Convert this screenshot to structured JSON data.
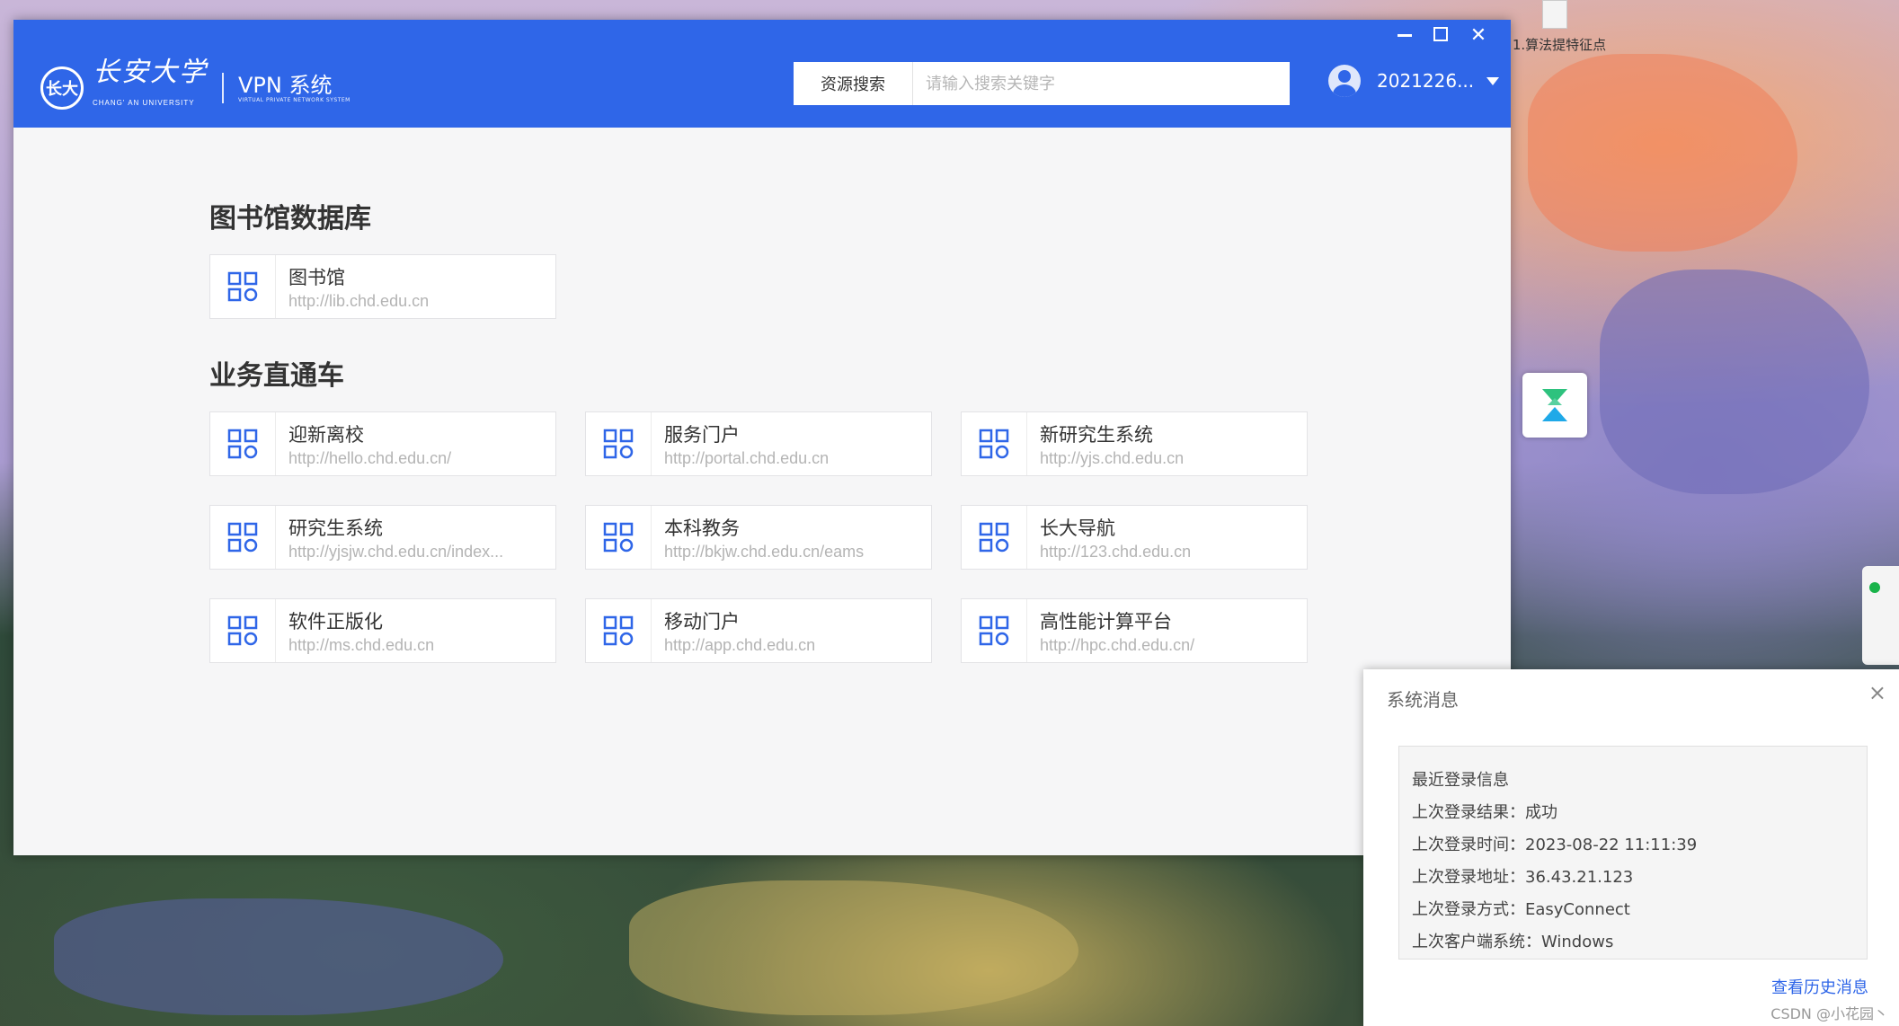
{
  "window": {
    "university_name": "长安大学",
    "university_sub": "CHANG' AN UNIVERSITY",
    "seal_text": "长大",
    "product_title": "VPN 系统",
    "product_sub": "VIRTUAL PRIVATE NETWORK SYSTEM",
    "brand_color": "#2f66e8"
  },
  "search": {
    "scope_label": "资源搜索",
    "placeholder": "请输入搜索关键字",
    "value": ""
  },
  "user": {
    "name": "2021226..."
  },
  "sections": [
    {
      "title": "图书馆数据库",
      "items": [
        {
          "name": "图书馆",
          "url": "http://lib.chd.edu.cn"
        }
      ]
    },
    {
      "title": "业务直通车",
      "items": [
        {
          "name": "迎新离校",
          "url": "http://hello.chd.edu.cn/"
        },
        {
          "name": "服务门户",
          "url": "http://portal.chd.edu.cn"
        },
        {
          "name": "新研究生系统",
          "url": "http://yjs.chd.edu.cn"
        },
        {
          "name": "研究生系统",
          "url": "http://yjsjw.chd.edu.cn/index..."
        },
        {
          "name": "本科教务",
          "url": "http://bkjw.chd.edu.cn/eams"
        },
        {
          "name": "长大导航",
          "url": "http://123.chd.edu.cn"
        },
        {
          "name": "软件正版化",
          "url": "http://ms.chd.edu.cn"
        },
        {
          "name": "移动门户",
          "url": "http://app.chd.edu.cn"
        },
        {
          "name": "高性能计算平台",
          "url": "http://hpc.chd.edu.cn/"
        }
      ]
    }
  ],
  "notification": {
    "title": "系统消息",
    "close_label": "×",
    "lines": [
      "最近登录信息",
      "上次登录结果：成功",
      "上次登录时间：2023-08-22 11:11:39",
      "上次登录地址：36.43.21.123",
      "上次登录方式：EasyConnect",
      "上次客户端系统：Windows"
    ],
    "history_link": "查看历史消息"
  },
  "desktop": {
    "icon_label": "1.算法提特征点",
    "watermark": "CSDN @小花园丶"
  },
  "icons": {
    "resource": "app-grid-icon",
    "close": "close-icon",
    "minimize": "minimize-icon",
    "maximize": "maximize-icon",
    "dropdown": "chevron-down-icon"
  }
}
